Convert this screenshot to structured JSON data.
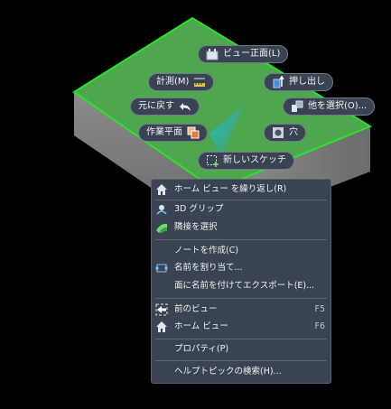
{
  "mini_toolbar": {
    "view_front": "ビュー正面(L)",
    "measure": "計測(M)",
    "push_pull": "押し出し",
    "undo": "元に戻す",
    "select_other": "他を選択(O)...",
    "work_plane": "作業平面",
    "hole": "穴",
    "new_sketch": "新しいスケッチ"
  },
  "context_menu": {
    "home_view_repeat": "ホーム ビュー を繰り返し(R)",
    "grip_3d": "3D グリップ",
    "select_tangent": "隣接を選択",
    "create_note": "ノートを作成(C)",
    "assign_name": "名前を割り当て...",
    "export_face": "面に名前を付けてエクスポート(E)...",
    "previous_view": "前のビュー",
    "previous_view_shortcut": "F5",
    "home_view": "ホーム ビュー",
    "home_view_shortcut": "F6",
    "properties": "プロパティ(P)",
    "help_search": "ヘルプトピックの検索(H)..."
  },
  "colors": {
    "face_highlight": "#4ea64e",
    "edge_highlight": "#29e329",
    "menu_bg": "#3a4352"
  }
}
